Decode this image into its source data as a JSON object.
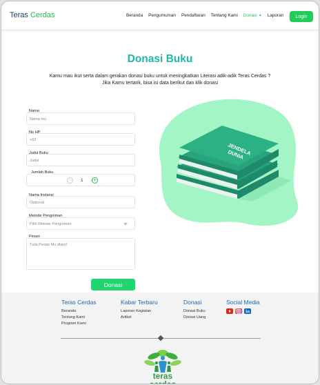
{
  "nav": {
    "brand_main": "Teras",
    "brand_accent": "Cerdas",
    "links": [
      "Beranda",
      "Pengumuman",
      "Pendaftaran",
      "Tentang Kami",
      "Donasi",
      "Laporan"
    ],
    "active_link": "Donasi",
    "login_label": "Login"
  },
  "page": {
    "title": "Donasi Buku",
    "intro_line1": "Kamu mau ikut serta dalam gerakan donasi buku untuk meningkatkan Literasi adik-adik Teras Cerdas ?",
    "intro_line2": "Jika Kamu tertarik, bisa isi data berikut dan klik donasi"
  },
  "form": {
    "nama_label": "Nama",
    "nama_placeholder": "Nama mu",
    "hp_label": "No HP",
    "hp_placeholder": "+62",
    "judul_label": "Judul Buku",
    "judul_placeholder": "Judul",
    "jumlah_label": "Jumlah Buku",
    "jumlah_value": "1",
    "instansi_label": "Nama Instansi",
    "instansi_placeholder": "Optional",
    "metode_label": "Metode Pengiriman",
    "metode_placeholder": "Pilih Metode Pengiriman",
    "pesan_label": "Pesan",
    "pesan_placeholder": "Tulis Pesan Mu disini!",
    "submit_label": "Donasi"
  },
  "illustration": {
    "book_text_line1": "JENDELA",
    "book_text_line2": "DUNIA"
  },
  "footer": {
    "col1_title": "Teras Cerdas",
    "col1_links": [
      "Beranda",
      "Tentang Kami",
      "Program Kami"
    ],
    "col2_title": "Kabar Terbaru",
    "col2_links": [
      "Laporan Kegiatan",
      "Artikel"
    ],
    "col3_title": "Donasi",
    "col3_links": [
      "Donasi Buku",
      "Donasi Uang"
    ],
    "col4_title": "Social Media",
    "social_icons": [
      "youtube-icon",
      "instagram-icon",
      "linkedin-icon"
    ],
    "logo_text": "teras cerdas"
  },
  "colors": {
    "brand_green": "#22b84c",
    "title_teal": "#1fb8a4",
    "button_green": "#1fd56e",
    "footer_blue": "#1a67b0"
  }
}
